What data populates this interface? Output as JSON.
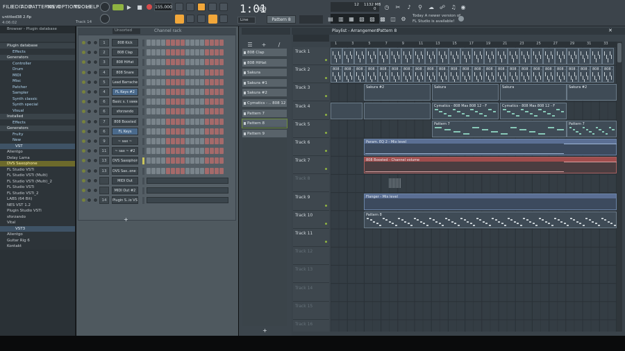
{
  "menu": [
    "FILE",
    "EDIT",
    "ADD",
    "PATTERNS",
    "VIEW",
    "OPTIONS",
    "TOOLS",
    "HELP"
  ],
  "project": {
    "file": "untitled38 2.flp",
    "time": "4:06:02",
    "hint_track": "Track 14"
  },
  "transport": {
    "tempo": "155.000",
    "time": "1:01",
    "time_small": "00",
    "pattern": "Pattern 8",
    "snap": "Line",
    "cpu": "12",
    "mem": "1132 MB",
    "voices": "0"
  },
  "news": {
    "line1": "Today  A newer version of",
    "line2": "FL Studio is available!"
  },
  "browser": {
    "title": "Browser - Plugin database",
    "rows": [
      {
        "text": "Plugin database",
        "kind": "head"
      },
      {
        "text": "Effects",
        "kind": "gen"
      },
      {
        "text": "Generators",
        "kind": "head"
      },
      {
        "text": "Controller",
        "kind": "gen"
      },
      {
        "text": "Drum",
        "kind": "gen"
      },
      {
        "text": "MIDI",
        "kind": "gen"
      },
      {
        "text": "Misc",
        "kind": "gen"
      },
      {
        "text": "Patcher",
        "kind": "gen"
      },
      {
        "text": "Sampler",
        "kind": "gen"
      },
      {
        "text": "Synth classic",
        "kind": "gen"
      },
      {
        "text": "Synth special",
        "kind": "gen"
      },
      {
        "text": "Visual",
        "kind": "gen"
      },
      {
        "text": "Installed",
        "kind": "head"
      },
      {
        "text": "Effects",
        "kind": "gen"
      },
      {
        "text": "Generators",
        "kind": "head"
      },
      {
        "text": "Fruity",
        "kind": "gen"
      },
      {
        "text": "New",
        "kind": "gen"
      },
      {
        "text": "VST",
        "kind": "sel"
      },
      {
        "text": "Alientgo",
        "kind": "plug"
      },
      {
        "text": "Delay Lama",
        "kind": "plug"
      },
      {
        "text": "DVS Saxophone",
        "kind": "hl"
      },
      {
        "text": "FL Studio VSTi",
        "kind": "plug"
      },
      {
        "text": "FL Studio VSTi (Multi)",
        "kind": "plug"
      },
      {
        "text": "FL Studio VSTi (Multi)_2",
        "kind": "plug"
      },
      {
        "text": "FL Studio VSTi",
        "kind": "plug"
      },
      {
        "text": "FL Studio VSTi_2",
        "kind": "plug"
      },
      {
        "text": "LABS (64 Bit)",
        "kind": "plug"
      },
      {
        "text": "NES VST 1.2",
        "kind": "plug"
      },
      {
        "text": "Plugin Studio VSTi",
        "kind": "plug"
      },
      {
        "text": "sforzando",
        "kind": "plug"
      },
      {
        "text": "Vital",
        "kind": "plug"
      },
      {
        "text": "VST3",
        "kind": "sel"
      },
      {
        "text": "Alientgo",
        "kind": "plug"
      },
      {
        "text": "Guitar Rig 6",
        "kind": "plug"
      },
      {
        "text": "Kontakt",
        "kind": "plug"
      },
      {
        "text": "LABS (64 Bit)",
        "kind": "plug"
      },
      {
        "text": "sforzando",
        "kind": "plug"
      },
      {
        "text": "Vital",
        "kind": "plug"
      }
    ]
  },
  "rack": {
    "title": "Channel rack",
    "filter": "Unsorted",
    "channels": [
      {
        "num": "1",
        "name": "808 Kick",
        "sel": false
      },
      {
        "num": "2",
        "name": "808 Clap",
        "sel": false
      },
      {
        "num": "3",
        "name": "808 HiHat",
        "sel": false
      },
      {
        "num": "4",
        "name": "808 Snare",
        "sel": false
      },
      {
        "num": "5",
        "name": "Lead Barraches",
        "sel": false
      },
      {
        "num": "4",
        "name": "FL Keys #2",
        "sel": true
      },
      {
        "num": "6",
        "name": "Basic s. t sweep",
        "sel": false
      },
      {
        "num": "6",
        "name": "sforzando",
        "sel": false
      },
      {
        "num": "7",
        "name": "808 Boosted",
        "sel": false
      },
      {
        "num": "6",
        "name": "FL Keys",
        "sel": true
      },
      {
        "num": "9",
        "name": "~ sax ~",
        "sel": false
      },
      {
        "num": "11",
        "name": "~ sax ~ #2",
        "sel": false
      },
      {
        "num": "13",
        "name": "DVS Saxophone",
        "sel": false
      },
      {
        "num": "13",
        "name": "DVS Sax..one #2",
        "sel": false
      },
      {
        "num": "",
        "name": "MIDI Out",
        "sel": false
      },
      {
        "num": "",
        "name": "MIDI Out #2",
        "sel": false
      },
      {
        "num": "14",
        "name": "Plugin S..io VSTi",
        "sel": false
      }
    ]
  },
  "patterns": [
    {
      "name": "808 Clap",
      "sel": false
    },
    {
      "name": "808 HiHat",
      "sel": false
    },
    {
      "name": "Sakura",
      "sel": false
    },
    {
      "name": "Sakura #1",
      "sel": false
    },
    {
      "name": "Sakura #2",
      "sel": false
    },
    {
      "name": "Cymatics - .. 808 12 - F",
      "sel": false
    },
    {
      "name": "Pattern 7",
      "sel": false
    },
    {
      "name": "Pattern 8",
      "sel": true
    },
    {
      "name": "Pattern 9",
      "sel": false
    }
  ],
  "playlist": {
    "title": "Playlist - Arrangement",
    "pattern": "Pattern 8",
    "bars": [
      "1",
      "3",
      "5",
      "7",
      "9",
      "11",
      "13",
      "15",
      "17",
      "19",
      "21",
      "23",
      "25",
      "27",
      "29",
      "31",
      "33"
    ],
    "tracks": [
      {
        "name": "Track 1",
        "dim": false
      },
      {
        "name": "Track 2",
        "dim": false
      },
      {
        "name": "Track 3",
        "dim": false
      },
      {
        "name": "Track 4",
        "dim": false
      },
      {
        "name": "Track 5",
        "dim": false
      },
      {
        "name": "Track 6",
        "dim": false
      },
      {
        "name": "Track 7",
        "dim": false
      },
      {
        "name": "Track 8",
        "dim": true
      },
      {
        "name": "Track 9",
        "dim": false
      },
      {
        "name": "Track 10",
        "dim": false
      },
      {
        "name": "Track 11",
        "dim": false
      },
      {
        "name": "Track 12",
        "dim": true
      },
      {
        "name": "Track 13",
        "dim": true
      },
      {
        "name": "Track 14",
        "dim": true
      },
      {
        "name": "Track 15",
        "dim": true
      },
      {
        "name": "Track 16",
        "dim": true
      }
    ],
    "clips": {
      "sakura2": "Sakura #2",
      "sakura": "Sakura",
      "cymatics": "Cymatics - 808 Mas 808 12 - F",
      "pattern7": "Pattern 7",
      "param": "Param. EQ 2 - Mix level",
      "boosted": "808 Boosted - Channel volume",
      "flanger": "Flanger - Mix level",
      "pattern8": "Pattern 8",
      "hat": "808 .. Hat"
    }
  }
}
